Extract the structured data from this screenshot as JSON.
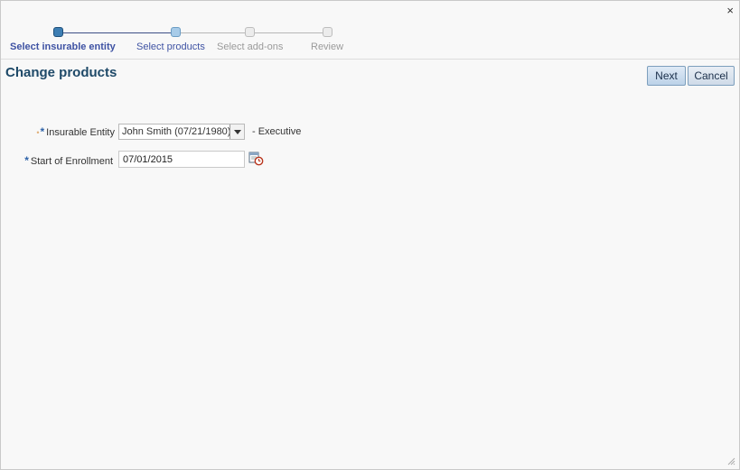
{
  "close_label": "×",
  "train": {
    "steps": [
      {
        "label": "Select insurable entity",
        "state": "visited"
      },
      {
        "label": "Select products",
        "state": "current"
      },
      {
        "label": "Select add-ons",
        "state": "unvisited"
      },
      {
        "label": "Review",
        "state": "unvisited"
      }
    ]
  },
  "page": {
    "title": "Change products"
  },
  "buttons": {
    "next": "Next",
    "cancel": "Cancel"
  },
  "form": {
    "insurable_entity": {
      "label": "Insurable Entity",
      "required_marker": "*",
      "value": "John Smith (07/21/1980)",
      "suffix": "- Executive"
    },
    "start_of_enrollment": {
      "label": "Start of Enrollment",
      "required_marker": "*",
      "value": "07/01/2015"
    }
  },
  "colors": {
    "accent": "#3e52a3",
    "title": "#1e4968",
    "required": "#2f64a9"
  },
  "icons": {
    "close": "close-icon",
    "dropdown": "chevron-down-icon",
    "calendar": "calendar-icon",
    "resize": "resize-grip-icon"
  }
}
